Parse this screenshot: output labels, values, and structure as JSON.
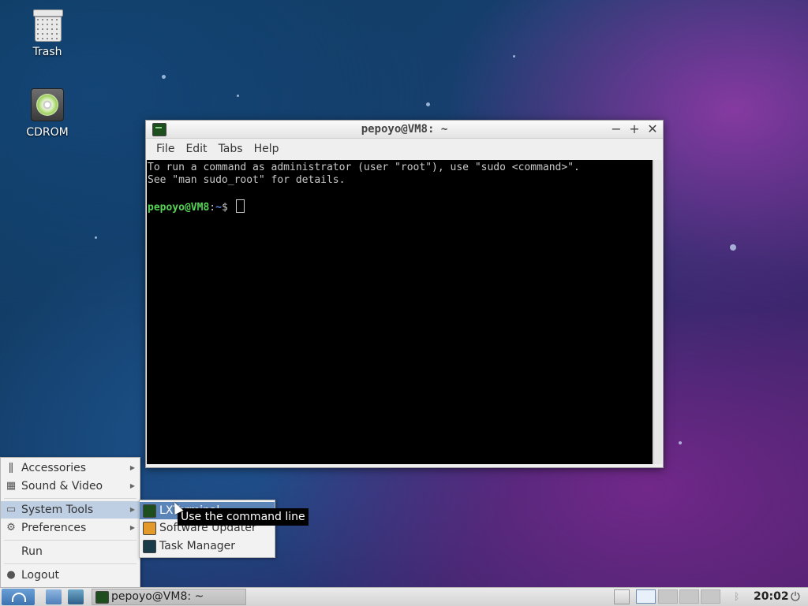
{
  "desktop": {
    "icons": [
      {
        "label": "Trash"
      },
      {
        "label": "CDROM"
      }
    ]
  },
  "terminal": {
    "title": "pepoyo@VM8: ~",
    "menu": [
      "File",
      "Edit",
      "Tabs",
      "Help"
    ],
    "lines": [
      "To run a command as administrator (user \"root\"), use \"sudo <command>\".",
      "See \"man sudo_root\" for details."
    ],
    "prompt_user": "pepoyo@VM8",
    "prompt_sep": ":",
    "prompt_path": "~",
    "prompt_symbol": "$"
  },
  "start_menu": {
    "items": [
      {
        "label": "Accessories",
        "icon": "accessories-icon"
      },
      {
        "label": "Sound & Video",
        "icon": "film-icon"
      },
      {
        "label": "System Tools",
        "icon": "monitor-icon"
      },
      {
        "label": "Preferences",
        "icon": "gear-icon"
      },
      {
        "label": "Run"
      },
      {
        "label": "Logout",
        "icon": "user-icon"
      }
    ],
    "submenu": [
      {
        "label": "LXTerminal",
        "icon": "terminal-icon"
      },
      {
        "label": "Software Updater",
        "icon": "updater-icon"
      },
      {
        "label": "Task Manager",
        "icon": "task-manager-icon"
      }
    ]
  },
  "tooltip": "Use the command line",
  "taskbar": {
    "task_label": "pepoyo@VM8: ~",
    "clock": "20:02"
  }
}
